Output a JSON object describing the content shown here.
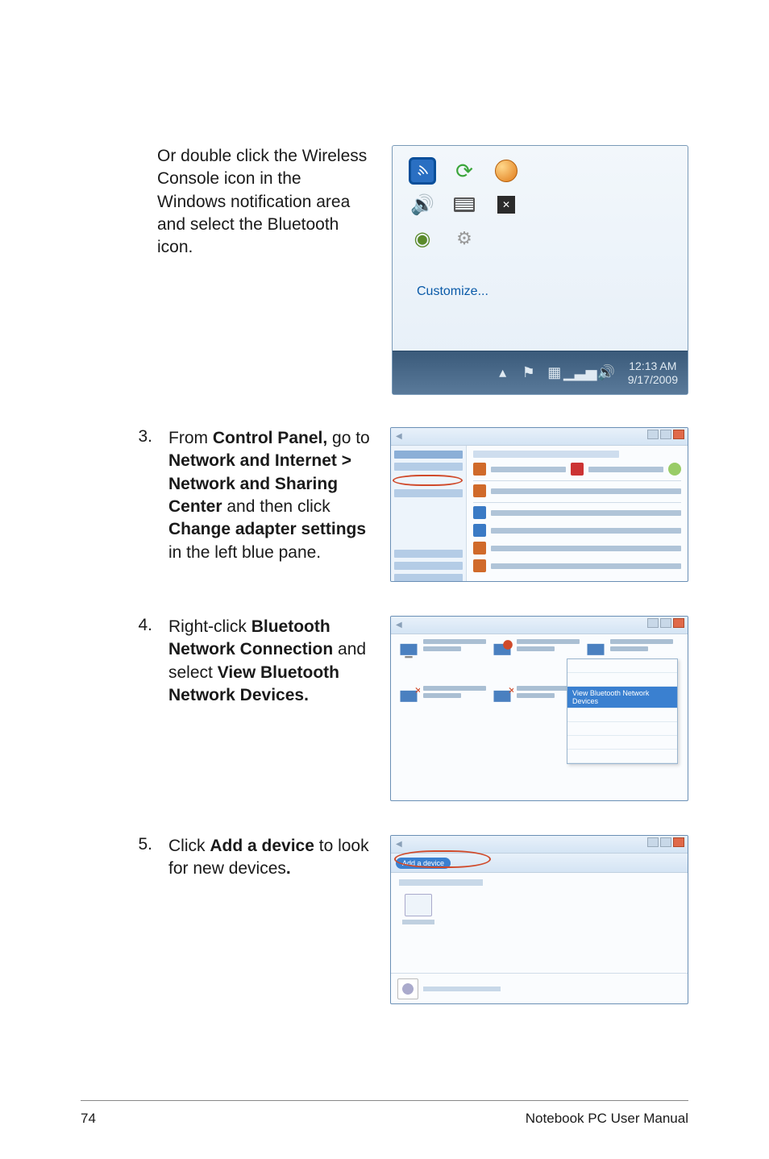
{
  "intro": "Or double click the Wireless Console icon in the Windows notification area and select the Bluetooth icon.",
  "tray": {
    "customize": "Customize...",
    "time": "12:13 AM",
    "date": "9/17/2009"
  },
  "step3": {
    "num": "3.",
    "pre": "From ",
    "bold1": "Control Panel,",
    "mid1": " go to ",
    "bold2": "Network and Internet > Network and Sharing Center",
    "mid2": " and then click ",
    "bold3": "Change adapter settings",
    "tail": " in the left blue pane."
  },
  "step4": {
    "num": "4.",
    "pre": "Right-click ",
    "bold1": "Bluetooth Network Connection",
    "mid1": " and select ",
    "bold2": "View Bluetooth Network Devices."
  },
  "step5": {
    "num": "5.",
    "pre": "Click ",
    "bold1": "Add a device",
    "mid1": " to look for new devices",
    "trail": "."
  },
  "footer": {
    "page": "74",
    "title": "Notebook PC User Manual"
  }
}
